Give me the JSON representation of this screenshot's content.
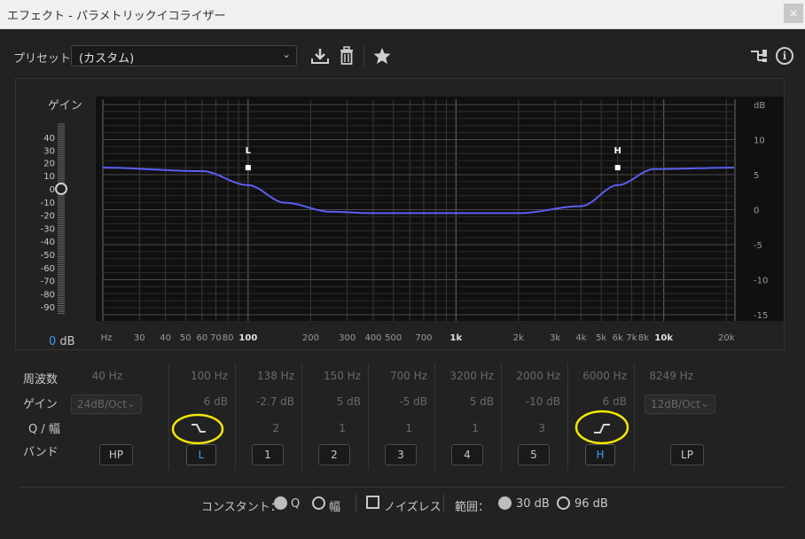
{
  "window": {
    "title": "エフェクト - パラメトリックイコライザー",
    "close_label": "×"
  },
  "toolbar": {
    "preset_label": "プリセット：",
    "preset_value": "(カスタム)"
  },
  "graph": {
    "gain_title": "ゲイン",
    "left_ticks": [
      "40",
      "30",
      "20",
      "10",
      "0",
      "-10",
      "-20",
      "-30",
      "-40",
      "-50",
      "-60",
      "-70",
      "-80",
      "-90"
    ],
    "right_ticks": [
      "dB",
      "10",
      "5",
      "0",
      "-5",
      "-10",
      "-15"
    ],
    "freq_ticks": [
      "Hz",
      "30",
      "40",
      "50",
      "60",
      "70",
      "80",
      "100",
      "200",
      "300",
      "400",
      "500",
      "700",
      "1k",
      "2k",
      "3k",
      "4k",
      "5k",
      "6k",
      "7k",
      "8k",
      "10k",
      "20k"
    ],
    "bottom_gain": {
      "value": "0",
      "unit": "dB"
    },
    "markers": [
      {
        "label": "L",
        "freq_hz": 100,
        "gain_db": 6
      },
      {
        "label": "H",
        "freq_hz": 6000,
        "gain_db": 6
      }
    ]
  },
  "chart_data": {
    "type": "line",
    "x_scale": "log",
    "xlim": [
      20,
      22000
    ],
    "ylim": [
      -15,
      15
    ],
    "series": [
      {
        "x": [
          20,
          60,
          100,
          150,
          250,
          400,
          1000,
          2000,
          4000,
          6000,
          9000,
          22000
        ],
        "y": [
          6,
          5.5,
          3.5,
          1.0,
          -0.3,
          -0.5,
          -0.5,
          -0.5,
          0.5,
          3.5,
          5.8,
          6
        ]
      }
    ]
  },
  "controls": {
    "row_labels": {
      "freq": "周波数",
      "gain": "ゲイン",
      "q": "Q / 幅",
      "band": "バンド"
    },
    "bands": [
      {
        "freq": "40 Hz",
        "slope": "24dB/Oct",
        "button": "HP"
      },
      {
        "freq_num": "100",
        "freq_unit": "Hz",
        "gain_num": "6",
        "gain_unit": "dB",
        "button": "L"
      },
      {
        "freq": "138 Hz",
        "gain": "-2.7 dB",
        "q": "2",
        "button": "1"
      },
      {
        "freq": "150 Hz",
        "gain": "5 dB",
        "q": "1",
        "button": "2"
      },
      {
        "freq": "700 Hz",
        "gain": "-5 dB",
        "q": "1",
        "button": "3"
      },
      {
        "freq": "3200 Hz",
        "gain": "5 dB",
        "q": "1",
        "button": "4"
      },
      {
        "freq": "2000 Hz",
        "gain": "-10 dB",
        "q": "3",
        "button": "5"
      },
      {
        "freq_num": "6000",
        "freq_unit": "Hz",
        "gain_num": "6",
        "gain_unit": "dB",
        "button": "H"
      },
      {
        "freq": "8249 Hz",
        "slope": "12dB/Oct",
        "button": "LP"
      }
    ]
  },
  "footer": {
    "constant_label": "コンスタント：",
    "q_label": "Q",
    "width_label": "幅",
    "noiseless_label": "ノイズレス",
    "range_label": "範囲：",
    "range_30": "30 dB",
    "range_96": "96 dB"
  },
  "colors": {
    "accent": "#3e9cf0",
    "curve": "#5a5ff0",
    "highlight": "#f5e800"
  }
}
